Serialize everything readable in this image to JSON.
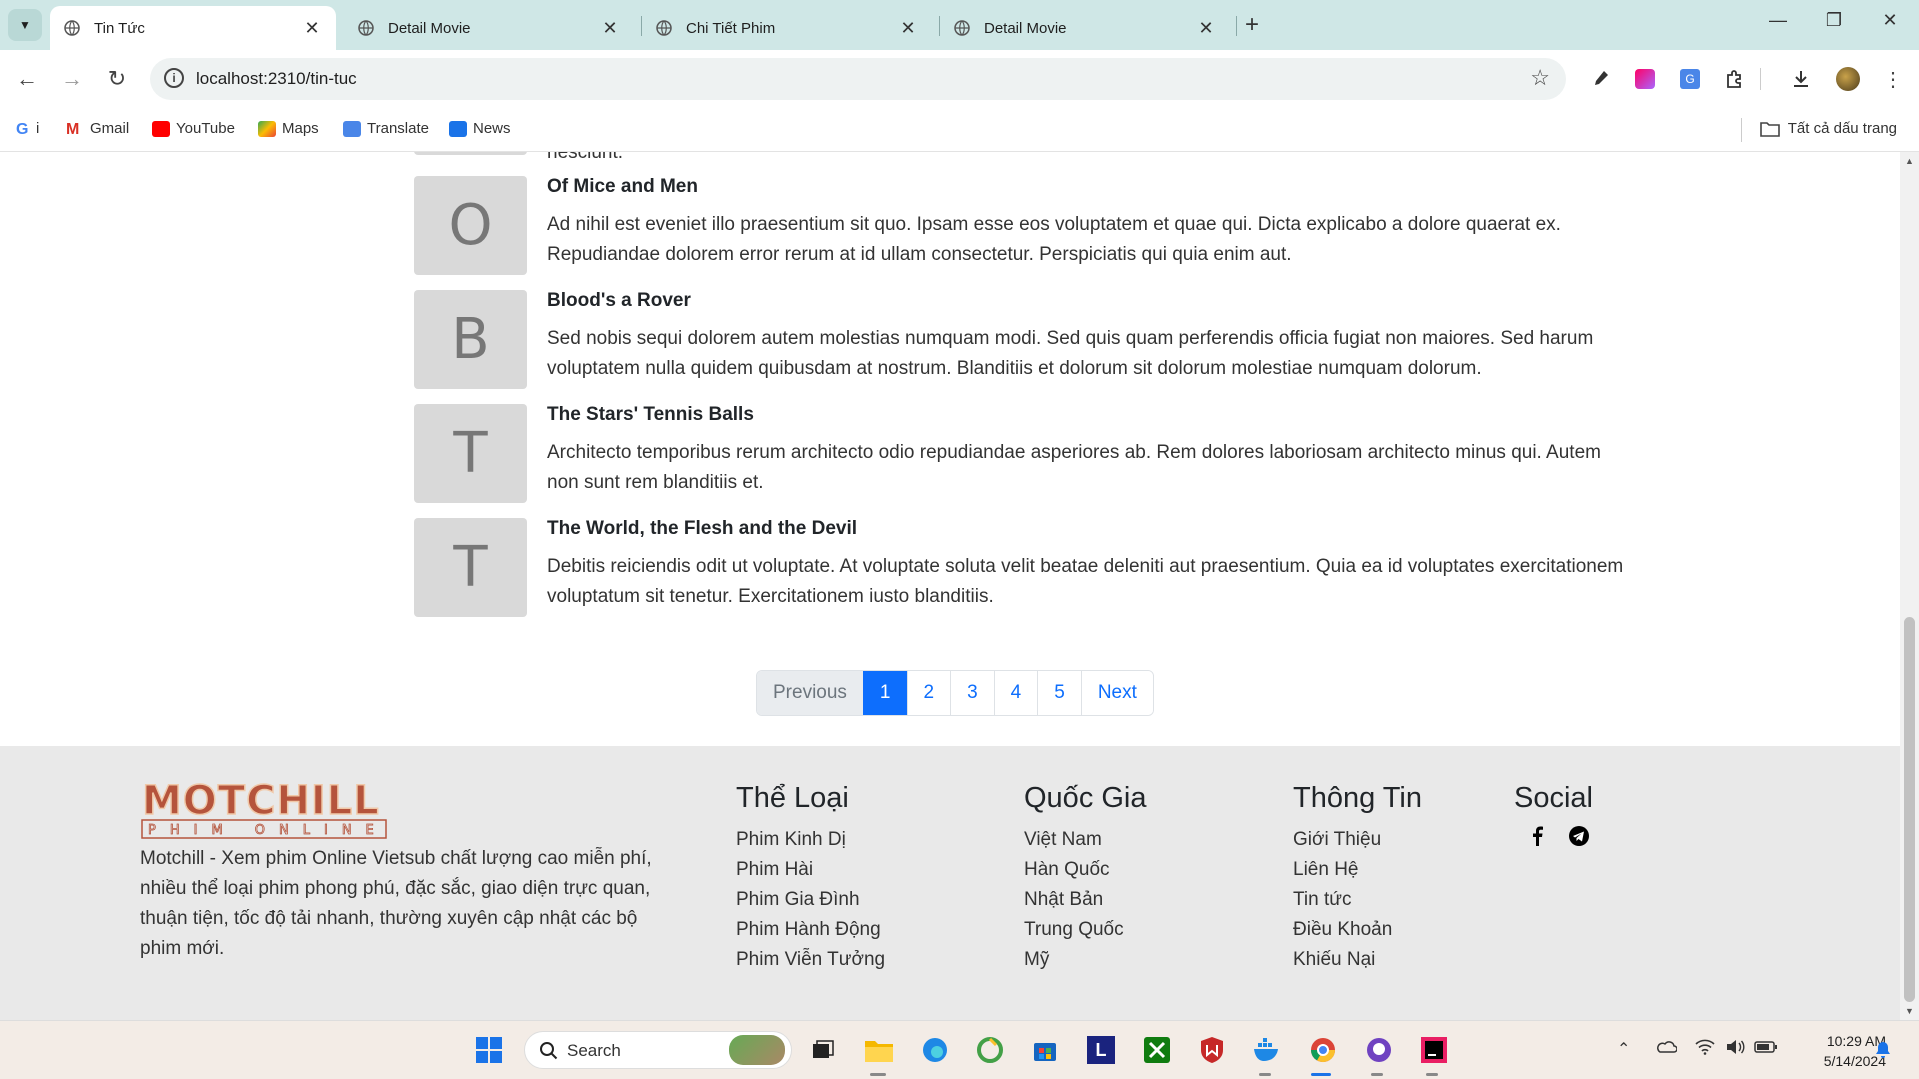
{
  "browser": {
    "tabs": [
      {
        "title": "Tin Tức",
        "active": true
      },
      {
        "title": "Detail Movie",
        "active": false
      },
      {
        "title": "Chi Tiết Phim",
        "active": false
      },
      {
        "title": "Detail Movie",
        "active": false
      }
    ],
    "url": "localhost:2310/tin-tuc",
    "bookmarks": [
      {
        "label": "i",
        "icon": "google-icon"
      },
      {
        "label": "Gmail",
        "icon": "gmail-icon"
      },
      {
        "label": "YouTube",
        "icon": "youtube-icon"
      },
      {
        "label": "Maps",
        "icon": "maps-icon"
      },
      {
        "label": "Translate",
        "icon": "translate-icon"
      },
      {
        "label": "News",
        "icon": "news-icon"
      }
    ],
    "all_bookmarks": "Tất cả dấu trang"
  },
  "news": [
    {
      "title": "",
      "desc": "nesciunt.",
      "letter": ""
    },
    {
      "title": "Of Mice and Men",
      "letter": "O",
      "desc": "Ad nihil est eveniet illo praesentium sit quo. Ipsam esse eos voluptatem et quae qui. Dicta explicabo a dolore quaerat ex. Repudiandae dolorem error rerum at id ullam consectetur. Perspiciatis qui quia enim aut."
    },
    {
      "title": "Blood's a Rover",
      "letter": "B",
      "desc": "Sed nobis sequi dolorem autem molestias numquam modi. Sed quis quam perferendis officia fugiat non maiores. Sed harum voluptatem nulla quidem quibusdam at nostrum. Blanditiis et dolorum sit dolorum molestiae numquam dolorum."
    },
    {
      "title": "The Stars' Tennis Balls",
      "letter": "T",
      "desc": "Architecto temporibus rerum architecto odio repudiandae asperiores ab. Rem dolores laboriosam architecto minus qui. Autem non sunt rem blanditiis et."
    },
    {
      "title": "The World, the Flesh and the Devil",
      "letter": "T",
      "desc": "Debitis reiciendis odit ut voluptate. At voluptate soluta velit beatae deleniti aut praesentium. Quia ea id voluptates exercitationem voluptatum sit tenetur. Exercitationem iusto blanditiis."
    }
  ],
  "pagination": {
    "previous": "Previous",
    "pages": [
      "1",
      "2",
      "3",
      "4",
      "5"
    ],
    "next": "Next",
    "current": "1"
  },
  "footer": {
    "logo_text": "MOTCHILL",
    "logo_sub": "PHIM ONLINE",
    "description": "Motchill - Xem phim Online Vietsub chất lượng cao miễn phí, nhiều thể loại phim phong phú, đặc sắc, giao diện trực quan, thuận tiện, tốc độ tải nhanh, thường xuyên cập nhật các bộ phim mới.",
    "genres": {
      "heading": "Thể Loại",
      "links": [
        "Phim Kinh Dị",
        "Phim Hài",
        "Phim Gia Đình",
        "Phim Hành Động",
        "Phim Viễn Tưởng"
      ]
    },
    "countries": {
      "heading": "Quốc Gia",
      "links": [
        "Việt Nam",
        "Hàn Quốc",
        "Nhật Bản",
        "Trung Quốc",
        "Mỹ"
      ]
    },
    "info": {
      "heading": "Thông Tin",
      "links": [
        "Giới Thiệu",
        "Liên Hệ",
        "Tin tức",
        "Điều Khoản",
        "Khiếu Nại"
      ]
    },
    "social": {
      "heading": "Social",
      "icons": [
        "facebook-icon",
        "telegram-icon"
      ]
    }
  },
  "taskbar": {
    "search_label": "Search",
    "time": "10:29 AM",
    "date": "5/14/2024"
  },
  "colors": {
    "accent": "#0d6efd",
    "footer_bg": "#e9e9e9",
    "tab_strip": "#cfe7e6",
    "logo": "#b5543c"
  }
}
